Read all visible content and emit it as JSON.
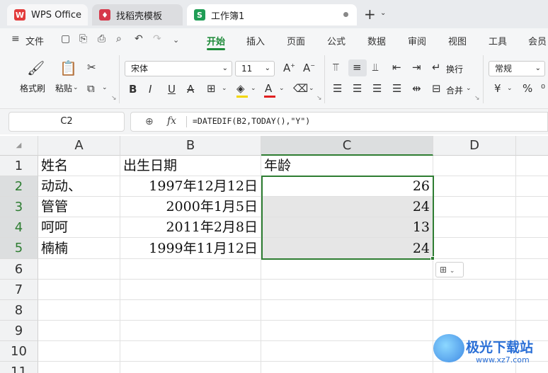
{
  "tabs": [
    {
      "label": "WPS Office"
    },
    {
      "label": "找稻壳模板"
    },
    {
      "label": "工作簿1"
    }
  ],
  "menu": {
    "file_label": "文件",
    "items": [
      "开始",
      "插入",
      "页面",
      "公式",
      "数据",
      "审阅",
      "视图",
      "工具",
      "会员"
    ]
  },
  "ribbon": {
    "format_painter": "格式刷",
    "paste": "粘贴",
    "font_name": "宋体",
    "font_size": "11",
    "wrap_text": "换行",
    "merge": "合并",
    "number_format": "常规",
    "currency_symbol": "¥",
    "percent_symbol": "%"
  },
  "formula_bar": {
    "name_box": "C2",
    "fx": "fx",
    "formula": "=DATEDIF(B2,TODAY(),\"Y\")"
  },
  "sheet": {
    "columns": [
      "A",
      "B",
      "C",
      "D"
    ],
    "rows": [
      "1",
      "2",
      "3",
      "4",
      "5",
      "6",
      "7",
      "8",
      "9",
      "10",
      "11"
    ],
    "cells": {
      "A1": "姓名",
      "B1": "出生日期",
      "C1": "年龄",
      "A2": "动动、",
      "B2": "1997年12月12日",
      "C2": "26",
      "A3": "管管",
      "B3": "2000年1月5日",
      "C3": "24",
      "A4": "呵呵",
      "B4": "2011年2月8日",
      "C4": "13",
      "A5": "楠楠",
      "B5": "1999年11月12日",
      "C5": "24"
    }
  },
  "watermark": {
    "title": "极光下载站",
    "url": "www.xz7.com"
  },
  "colors": {
    "selection_border": "#2e7d32",
    "active_tab_text": "#1f8b3a",
    "wps_red": "#e23b3b"
  }
}
